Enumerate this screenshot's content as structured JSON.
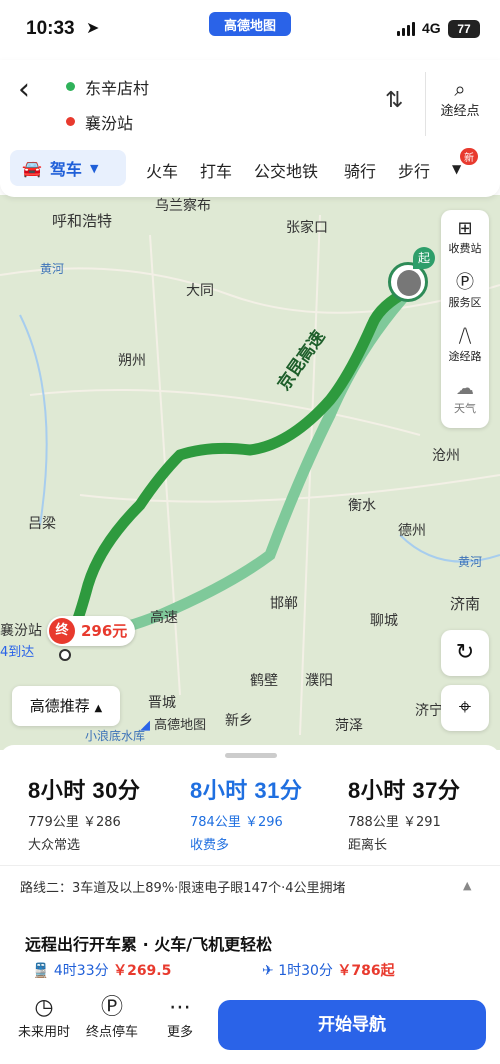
{
  "status": {
    "time": "10:33",
    "badge": "高德地图",
    "network": "4G",
    "battery": "77"
  },
  "header": {
    "origin": "东辛店村",
    "destination": "襄汾站",
    "via_label": "途经点"
  },
  "modes": {
    "active": "驾车",
    "items": [
      "火车",
      "打车",
      "公交地铁",
      "骑行",
      "步行"
    ],
    "new_badge": "新"
  },
  "map": {
    "cities": [
      "呼和浩特",
      "乌兰察布",
      "张家口",
      "黄河",
      "大同",
      "朔州",
      "沧州",
      "衡水",
      "德州",
      "吕梁",
      "黄河",
      "邯郸",
      "聊城",
      "济南",
      "晋城",
      "鹤壁",
      "濮阳",
      "新乡",
      "菏泽",
      "济宁",
      "小浪底水库",
      "襄汾站",
      "4到达"
    ],
    "highway": "京昆高速",
    "highway2": "高速",
    "tools": [
      "收费站",
      "服务区",
      "途经路",
      "天气"
    ],
    "recommend": "高德推荐",
    "logo": "高德地图",
    "end_label": "终",
    "end_price": "296元",
    "start_label": "起",
    "route_color_main": "#2e9a3e",
    "route_color_alt": "#7fc99a"
  },
  "routes": [
    {
      "time": "8小时 30分",
      "info": "779公里 ￥286",
      "tag": "大众常选"
    },
    {
      "time": "8小时 31分",
      "info": "784公里 ￥296",
      "tag": "收费多"
    },
    {
      "time": "8小时 37分",
      "info": "788公里 ￥291",
      "tag": "距离长"
    }
  ],
  "detail": "路线二：3车道及以上89%·限速电子眼147个·4公里拥堵",
  "promo": {
    "title": "远程出行开车累 · 火车/飞机更轻松",
    "train_time": "4时33分",
    "train_price": "￥269.5",
    "plane_time": "1时30分",
    "plane_price": "￥786起"
  },
  "bottom": {
    "future": "未来用时",
    "parking": "终点停车",
    "more": "更多",
    "start_nav": "开始导航"
  }
}
